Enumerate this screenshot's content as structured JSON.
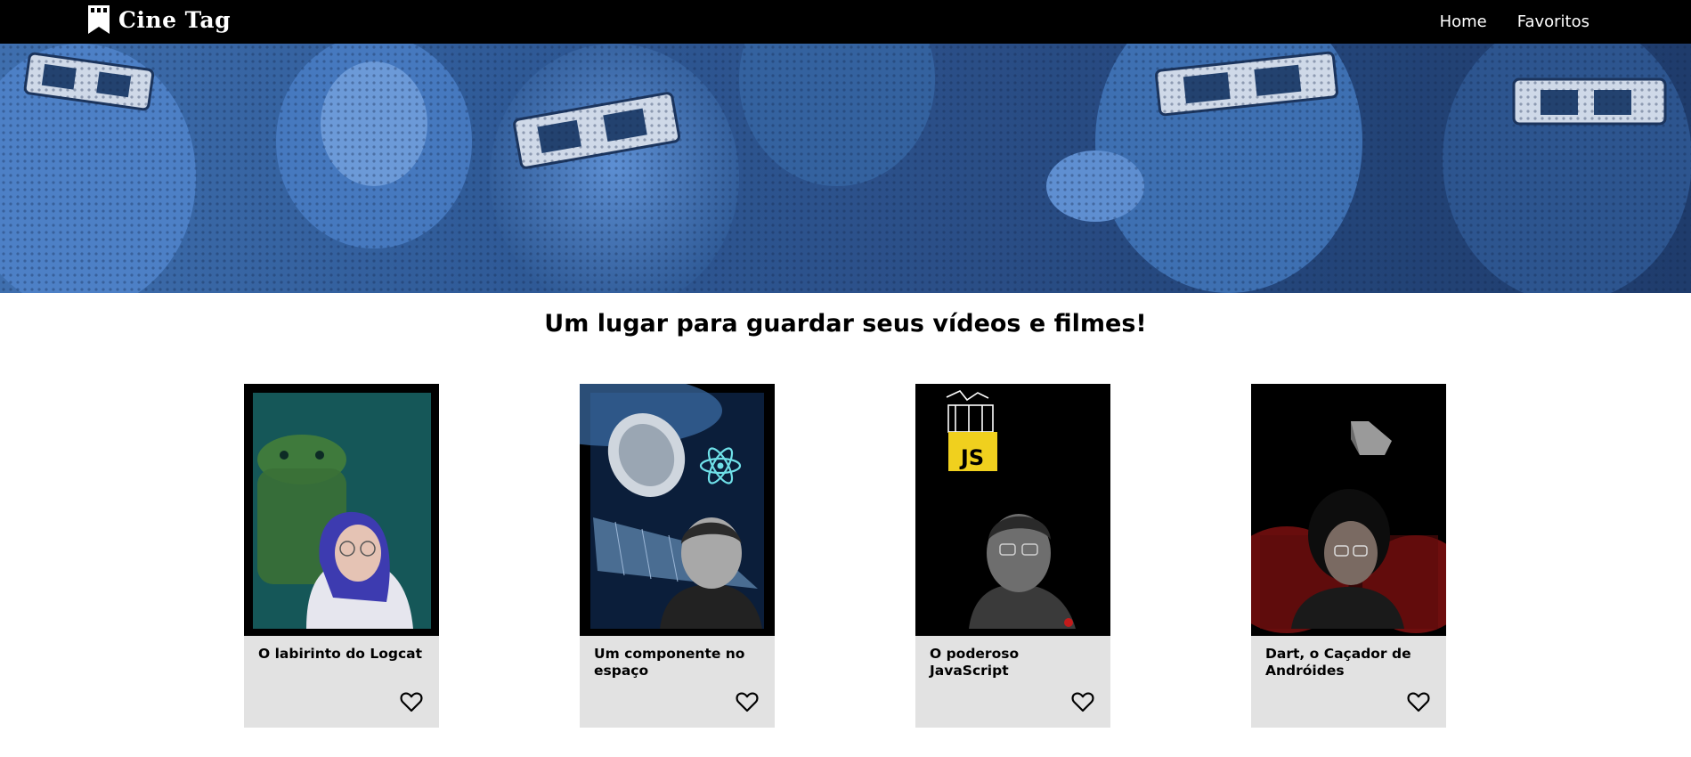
{
  "header": {
    "brand": "Cine Tag",
    "nav": [
      {
        "label": "Home"
      },
      {
        "label": "Favoritos"
      }
    ]
  },
  "main": {
    "tagline": "Um lugar para guardar seus vídeos e filmes!"
  },
  "cards": [
    {
      "title": "O labirinto do Logcat",
      "favorite_icon": "heart-outline-icon"
    },
    {
      "title": "Um componente no espaço",
      "favorite_icon": "heart-outline-icon"
    },
    {
      "title": "O poderoso JavaScript",
      "favorite_icon": "heart-outline-icon",
      "badge": "JS"
    },
    {
      "title": "Dart, o Caçador de Andróides",
      "favorite_icon": "heart-outline-icon"
    }
  ],
  "colors": {
    "header_bg": "#000000",
    "banner_tint": "#3a6bb0",
    "card_bg": "#e2e2e2",
    "js_yellow": "#f0d01e"
  }
}
